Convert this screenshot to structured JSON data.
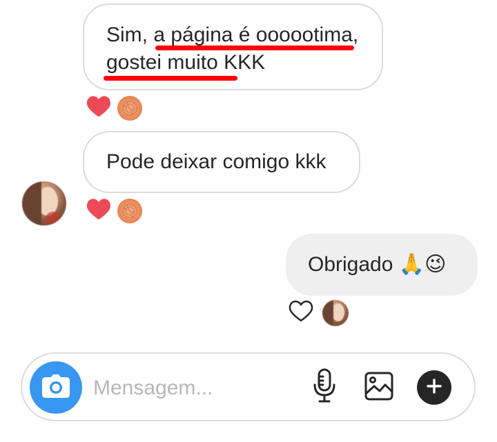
{
  "conversation": {
    "messages": [
      {
        "direction": "incoming",
        "lines": [
          "Sim, a página é oooot ima,",
          "gostei muito KKK"
        ],
        "text": "Sim, a página é oooootima,\ngostei muito KKK",
        "reactions": [
          "heart-icon",
          "reactor-badge"
        ]
      },
      {
        "direction": "incoming",
        "text": "Pode deixar comigo kkk",
        "reactions": [
          "heart-icon",
          "reactor-badge"
        ]
      },
      {
        "direction": "outgoing",
        "text": "Obrigado 🙏😉",
        "reactions": [
          "heart-outline-icon",
          "avatar"
        ]
      }
    ]
  },
  "composer": {
    "placeholder": "Mensagem...",
    "icons": [
      "camera-icon",
      "microphone-icon",
      "gallery-icon",
      "plus-icon"
    ]
  },
  "colors": {
    "heart": "#ed4956",
    "camera_button": "#3897f0",
    "underline": "#ff0000",
    "bubble_outgoing": "#efefef",
    "border": "#dbdbdb"
  }
}
